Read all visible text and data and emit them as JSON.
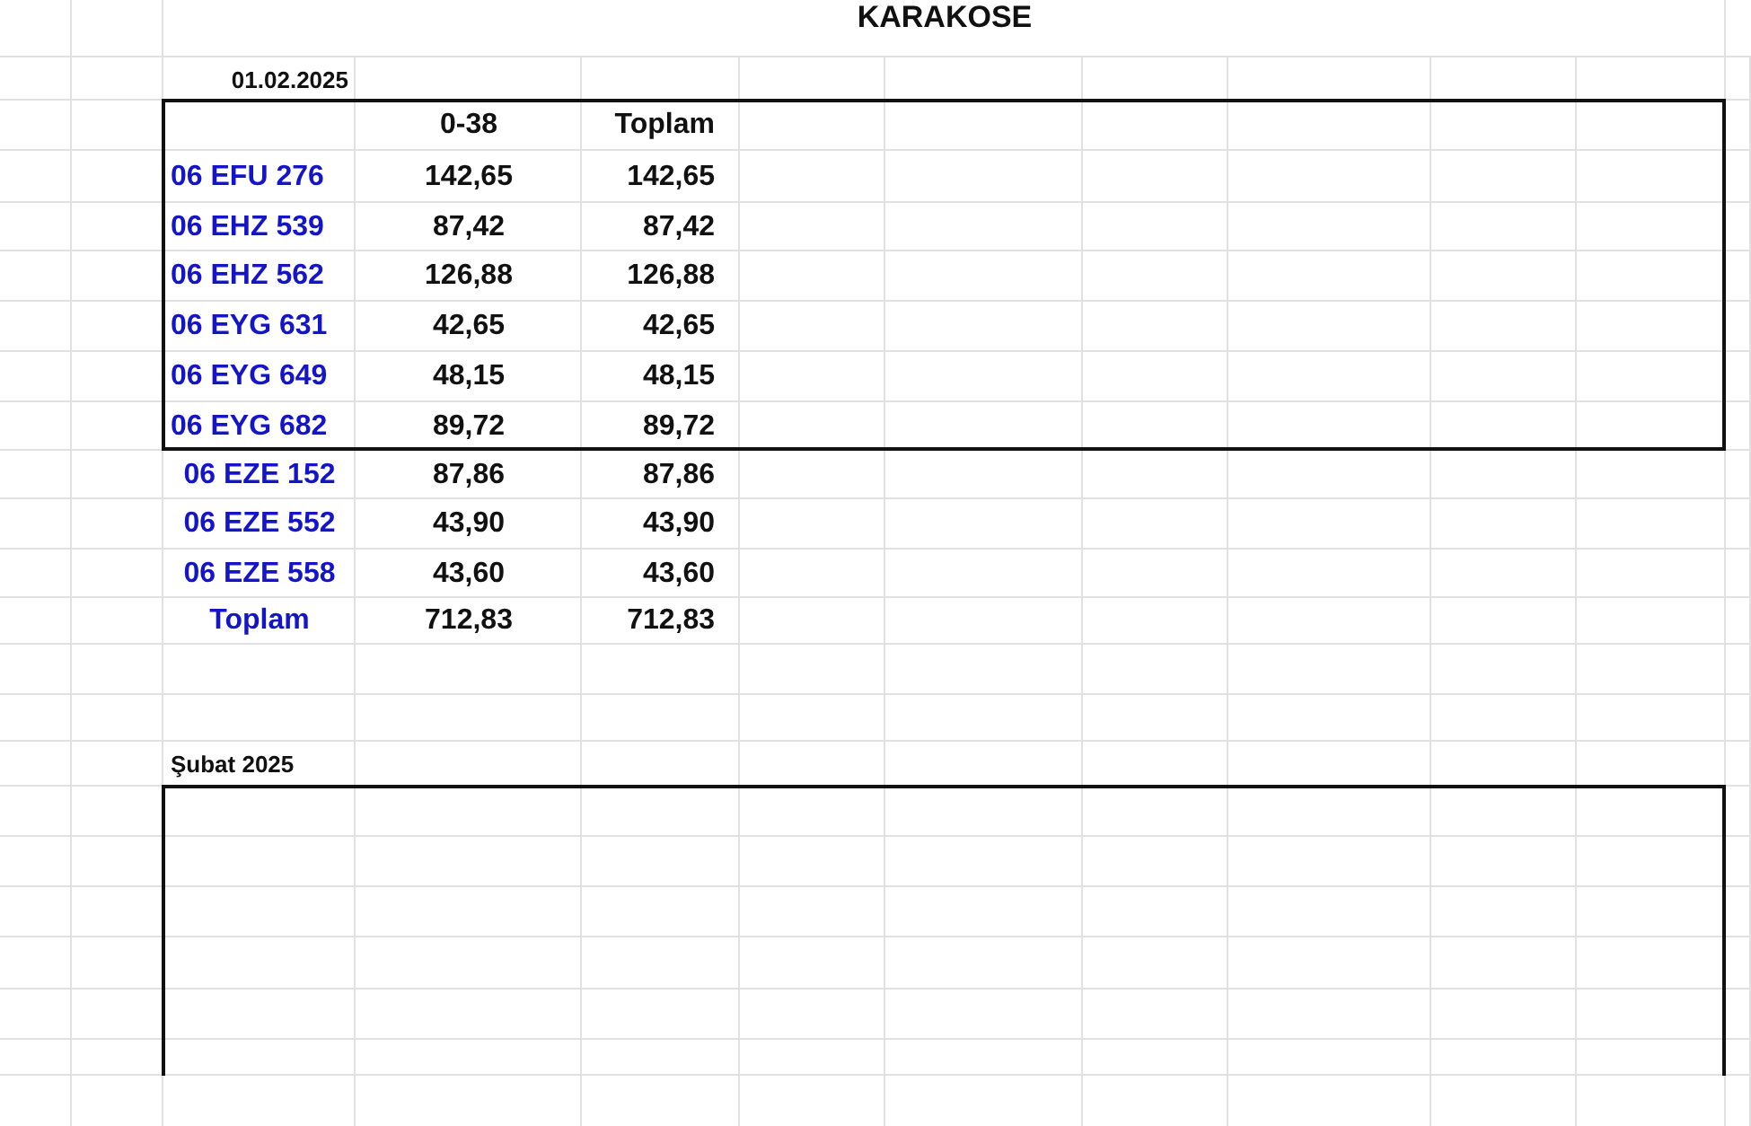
{
  "title": "KARAKOSE",
  "date": "01.02.2025",
  "columns": [
    "0-38",
    "Toplam"
  ],
  "rows": [
    {
      "plate": "06 EFU 276",
      "boxed": true,
      "values": [
        "142,65",
        "142,65"
      ]
    },
    {
      "plate": "06 EHZ 539",
      "boxed": true,
      "values": [
        "87,42",
        "87,42"
      ]
    },
    {
      "plate": "06 EHZ 562",
      "boxed": true,
      "values": [
        "126,88",
        "126,88"
      ]
    },
    {
      "plate": "06 EYG 631",
      "boxed": true,
      "values": [
        "42,65",
        "42,65"
      ]
    },
    {
      "plate": "06 EYG 649",
      "boxed": true,
      "values": [
        "48,15",
        "48,15"
      ]
    },
    {
      "plate": "06 EYG 682",
      "boxed": true,
      "values": [
        "89,72",
        "89,72"
      ]
    },
    {
      "plate": "06 EZE 152",
      "boxed": false,
      "values": [
        "87,86",
        "87,86"
      ]
    },
    {
      "plate": "06 EZE 552",
      "boxed": false,
      "values": [
        "43,90",
        "43,90"
      ]
    },
    {
      "plate": "06 EZE 558",
      "boxed": false,
      "values": [
        "43,60",
        "43,60"
      ]
    }
  ],
  "total": {
    "label": "Toplam",
    "values": [
      "712,83",
      "712,83"
    ]
  },
  "section_title": "Şubat 2025"
}
